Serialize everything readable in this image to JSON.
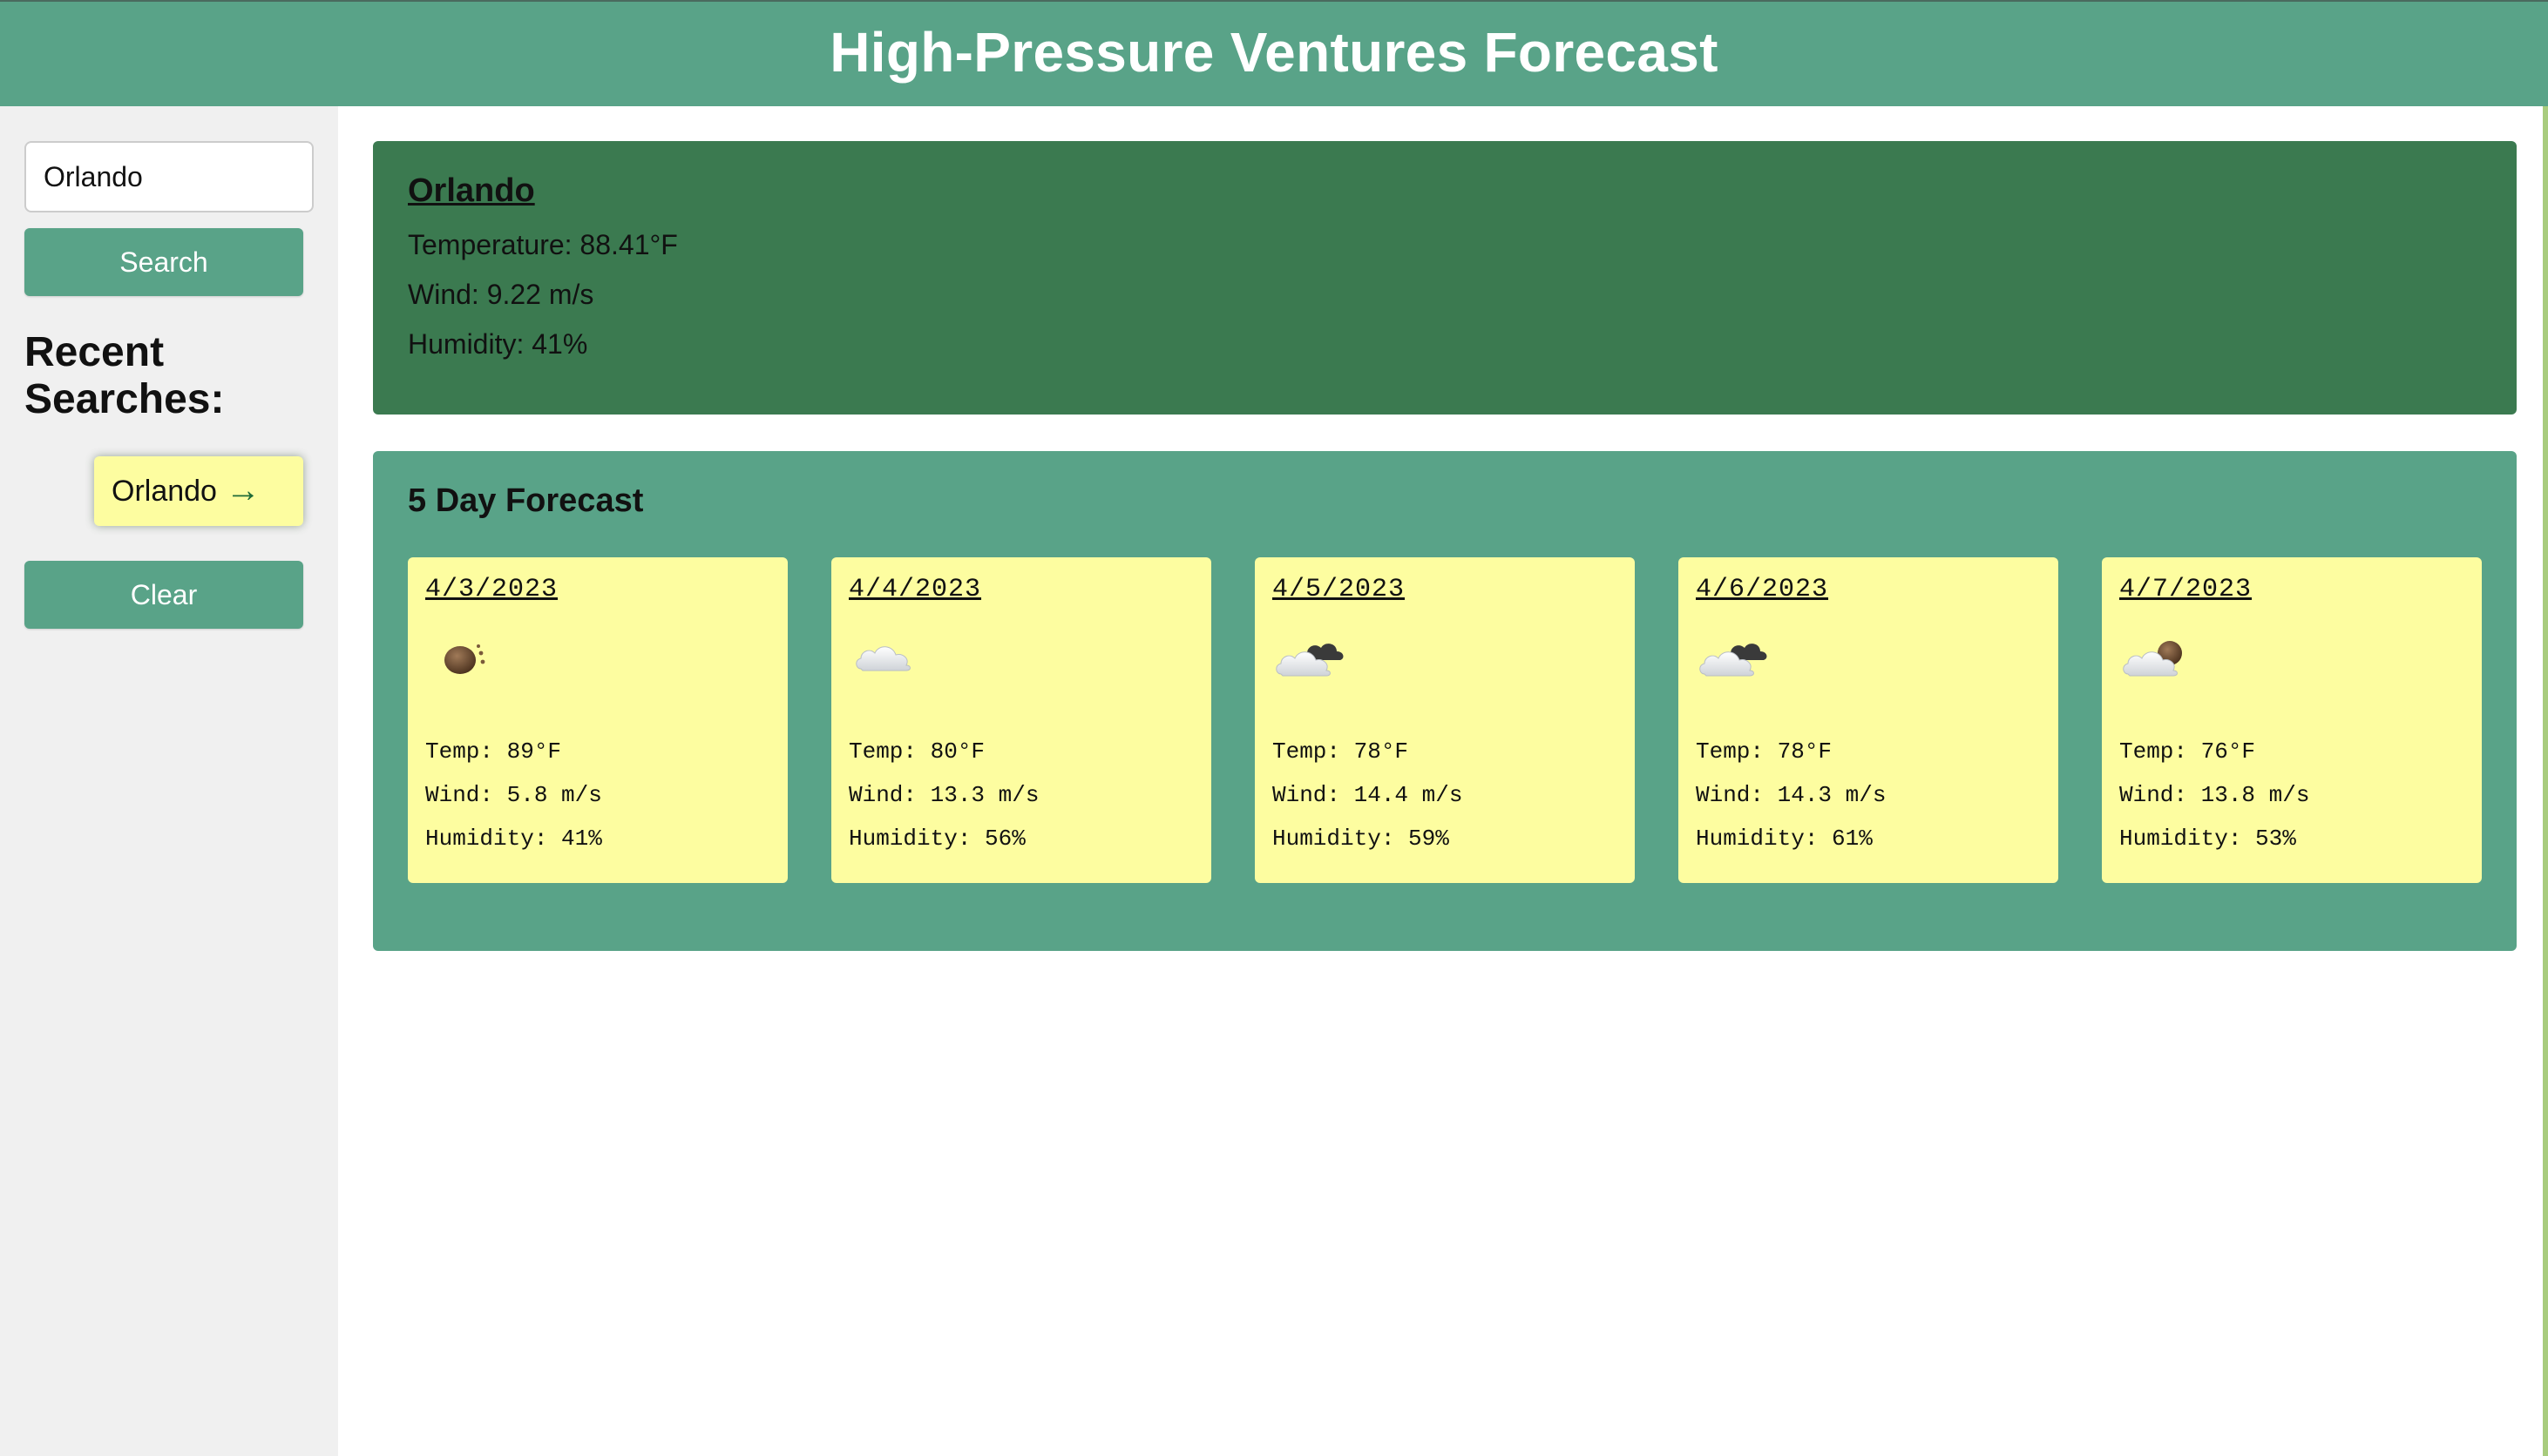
{
  "header": {
    "title": "High-Pressure Ventures Forecast"
  },
  "sidebar": {
    "search_value": "Orlando",
    "search_button": "Search",
    "recent_title": "Recent Searches:",
    "recent_items": [
      {
        "label": "Orlando",
        "arrow": "→"
      }
    ],
    "clear_button": "Clear"
  },
  "current": {
    "city": "Orlando",
    "temperature": "Temperature: 88.41°F",
    "wind": "Wind: 9.22 m/s",
    "humidity": "Humidity: 41%"
  },
  "forecast": {
    "title": "5 Day Forecast",
    "days": [
      {
        "date": "4/3/2023",
        "icon": "dark-sun-icon",
        "temp": "Temp: 89°F",
        "wind": "Wind: 5.8 m/s",
        "humidity": "Humidity: 41%"
      },
      {
        "date": "4/4/2023",
        "icon": "cloud-icon",
        "temp": "Temp: 80°F",
        "wind": "Wind: 13.3 m/s",
        "humidity": "Humidity: 56%"
      },
      {
        "date": "4/5/2023",
        "icon": "cloud-dark-cloud-icon",
        "temp": "Temp: 78°F",
        "wind": "Wind: 14.4 m/s",
        "humidity": "Humidity: 59%"
      },
      {
        "date": "4/6/2023",
        "icon": "cloud-dark-cloud-icon",
        "temp": "Temp: 78°F",
        "wind": "Wind: 14.3 m/s",
        "humidity": "Humidity: 61%"
      },
      {
        "date": "4/7/2023",
        "icon": "cloud-dark-sun-icon",
        "temp": "Temp: 76°F",
        "wind": "Wind: 13.8 m/s",
        "humidity": "Humidity: 53%"
      }
    ]
  },
  "colors": {
    "header_bg": "#59a388",
    "sidebar_bg": "#f0f0f0",
    "current_bg": "#3b7a50",
    "forecast_bg": "#59a388",
    "card_bg": "#fdfda0",
    "recent_bg": "#fdfda0"
  }
}
